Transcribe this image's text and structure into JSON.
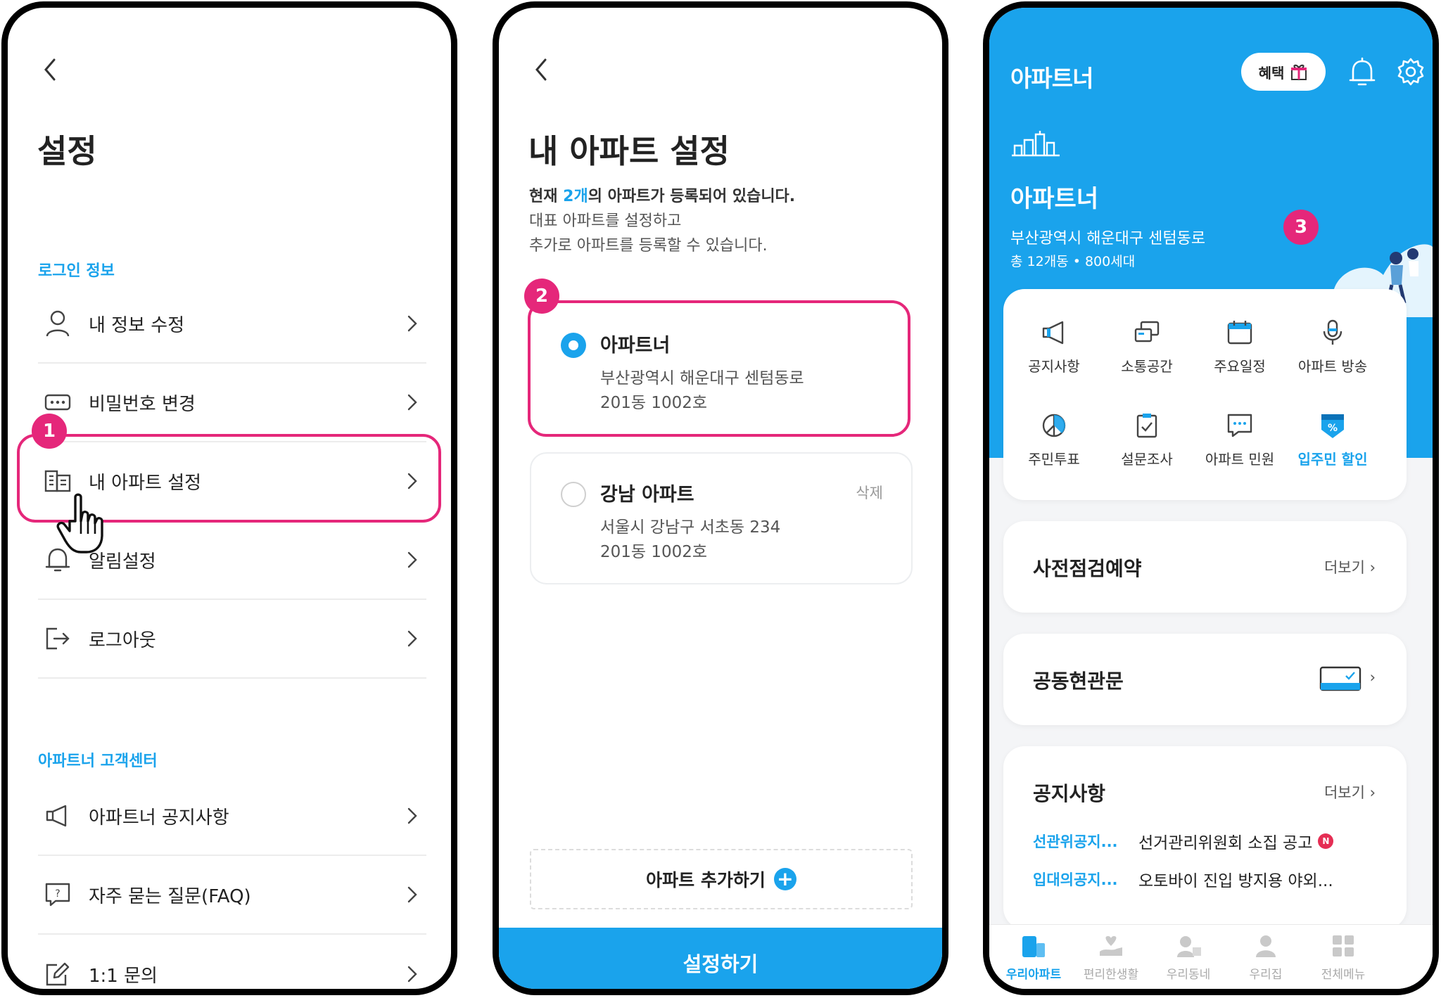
{
  "screen1": {
    "title": "설정",
    "section_login": "로그인 정보",
    "login_items": [
      {
        "label": "내 정보 수정"
      },
      {
        "label": "비밀번호 변경"
      },
      {
        "label": "내 아파트 설정"
      },
      {
        "label": "알림설정"
      },
      {
        "label": "로그아웃"
      }
    ],
    "section_center": "아파트너 고객센터",
    "center_items": [
      {
        "label": "아파트너 공지사항"
      },
      {
        "label": "자주 묻는 질문(FAQ)"
      },
      {
        "label": "1:1 문의"
      }
    ],
    "step_badge": "1"
  },
  "screen2": {
    "title": "내 아파트 설정",
    "desc_prefix": "현재 ",
    "desc_count": "2개",
    "desc_suffix": "의 아파트가 등록되어 있습니다.",
    "desc_line2": "대표 아파트를 설정하고",
    "desc_line3": "추가로 아파트를 등록할 수 있습니다.",
    "step_badge": "2",
    "apartments": [
      {
        "name": "아파트너",
        "address": "부산광역시 해운대구 센텀동로",
        "unit": "201동 1002호",
        "selected": true
      },
      {
        "name": "강남 아파트",
        "address": "서울시 강남구 서초동 234",
        "unit": "201동 1002호",
        "selected": false,
        "delete_label": "삭제"
      }
    ],
    "add_label": "아파트 추가하기",
    "submit_label": "설정하기"
  },
  "screen3": {
    "app_logo": "아파트너",
    "benefit_label": "혜택",
    "apt_name": "아파트너",
    "apt_address": "부산광역시 해운대구 센텀동로",
    "apt_info": "총 12개동 • 800세대",
    "step_badge": "3",
    "menu": [
      {
        "label": "공지사항",
        "icon": "megaphone-icon"
      },
      {
        "label": "소통공간",
        "icon": "chat-icon"
      },
      {
        "label": "주요일정",
        "icon": "calendar-icon"
      },
      {
        "label": "아파트 방송",
        "icon": "microphone-icon"
      },
      {
        "label": "주민투표",
        "icon": "vote-icon"
      },
      {
        "label": "설문조사",
        "icon": "clipboard-icon"
      },
      {
        "label": "아파트 민원",
        "icon": "message-icon"
      },
      {
        "label": "입주민 할인",
        "icon": "discount-icon",
        "highlight": true
      }
    ],
    "inspection_title": "사전점검예약",
    "more_label": "더보기",
    "entrance_title": "공동현관문",
    "notice_title": "공지사항",
    "notice_more": "더보기",
    "notices": [
      {
        "category": "선관위공지...",
        "title": "선거관리위원회 소집 공고",
        "new_badge": "N"
      },
      {
        "category": "입대의공지...",
        "title": "오토바이 진입 방지용 야외..."
      }
    ],
    "nav": [
      {
        "label": "우리아파트",
        "active": true
      },
      {
        "label": "편리한생활"
      },
      {
        "label": "우리동네"
      },
      {
        "label": "우리집"
      },
      {
        "label": "전체메뉴"
      }
    ]
  },
  "colors": {
    "accent": "#1aa3ec",
    "highlight": "#e5277a",
    "header_blue": "#1aa3ec"
  }
}
